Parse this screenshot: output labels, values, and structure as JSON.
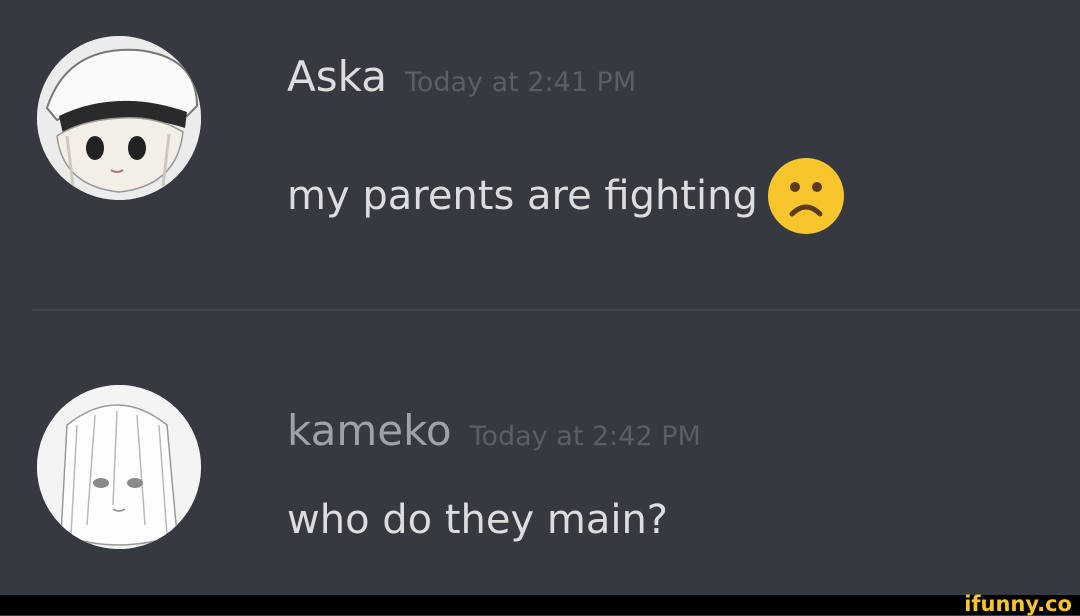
{
  "messages": [
    {
      "username": "Aska",
      "timestamp": "Today at 2:41 PM",
      "text": "my parents are fighting",
      "emoji": "frowning-face-icon"
    },
    {
      "username": "kameko",
      "timestamp": "Today at 2:42 PM",
      "text": "who do they main?"
    }
  ],
  "watermark": "ifunny.co",
  "colors": {
    "background": "#36393f",
    "text": "#dcddde",
    "timestamp": "#5b5e63",
    "watermark": "#f7c52c"
  }
}
